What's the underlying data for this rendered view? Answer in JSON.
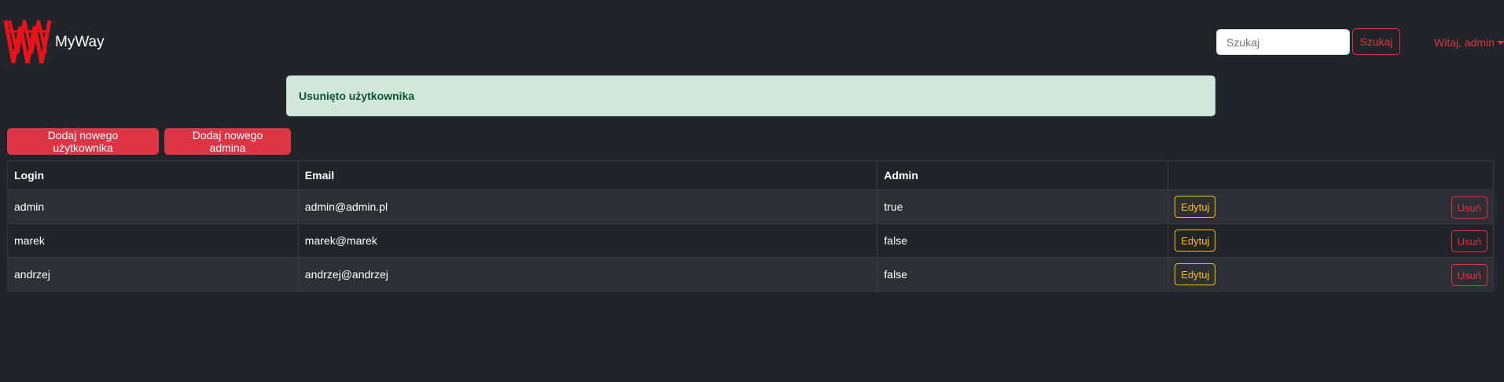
{
  "navbar": {
    "brand": "MyWay",
    "search_placeholder": "Szukaj",
    "search_button": "Szukaj",
    "user_menu": "Witaj, admin"
  },
  "alert": {
    "message": "Usunięto użytkownika"
  },
  "actions": {
    "add_user": "Dodaj nowego użytkownika",
    "add_admin": "Dodaj nowego admina"
  },
  "table": {
    "headers": [
      "Login",
      "Email",
      "Admin",
      ""
    ],
    "rows": [
      {
        "login": "admin",
        "email": "admin@admin.pl",
        "admin": "true"
      },
      {
        "login": "marek",
        "email": "marek@marek",
        "admin": "false"
      },
      {
        "login": "andrzej",
        "email": "andrzej@andrzej",
        "admin": "false"
      }
    ],
    "edit_label": "Edytuj",
    "delete_label": "Usuń"
  },
  "colors": {
    "background": "#212529",
    "accent": "#dc3545",
    "warning": "#ffc107",
    "success_bg": "#d1e7dd",
    "success_text": "#0f5132"
  }
}
